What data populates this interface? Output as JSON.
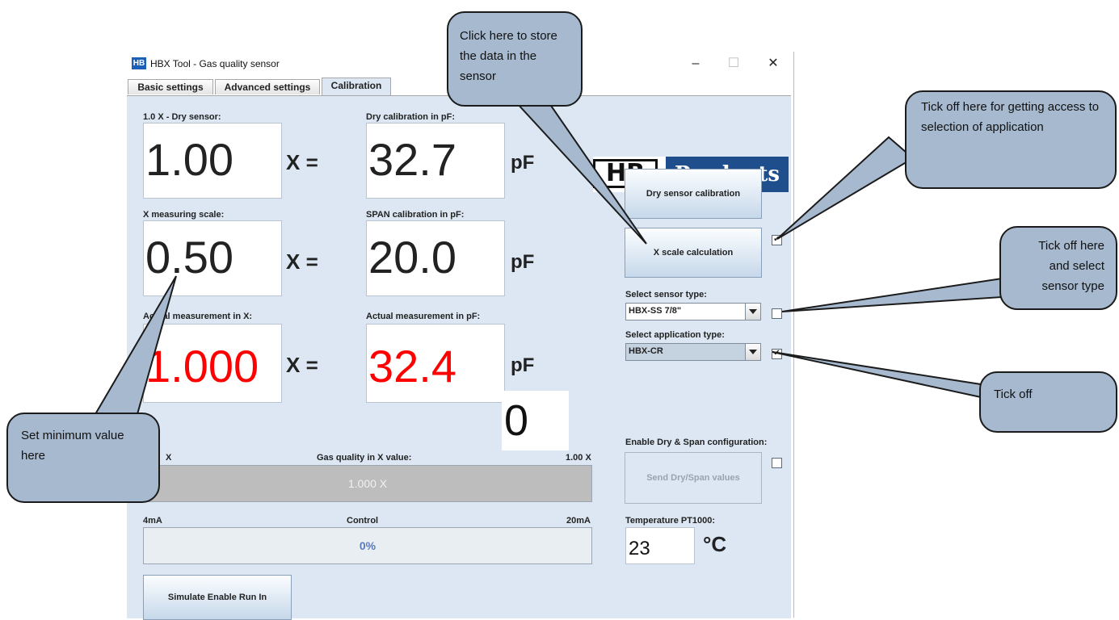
{
  "window": {
    "icon_text": "HB",
    "title": "HBX Tool - Gas quality sensor",
    "minimize": "–",
    "maximize": "☐",
    "close": "✕"
  },
  "tabs": [
    {
      "label": "Basic settings"
    },
    {
      "label": "Advanced settings"
    },
    {
      "label": "Calibration",
      "active": true
    }
  ],
  "calibration": {
    "dry_sensor_label": "1.0 X - Dry sensor:",
    "dry_sensor_value": "1.00",
    "dry_cal_label": "Dry calibration in pF:",
    "dry_cal_value": "32.7",
    "x_scale_label": "X measuring scale:",
    "x_scale_value": "0.50",
    "span_cal_label": "SPAN calibration in pF:",
    "span_cal_value": "20.0",
    "actual_x_label": "Actual measurement in X:",
    "actual_x_value": "1.000",
    "actual_pf_label": "Actual measurement in pF:",
    "actual_pf_value": "32.4",
    "eq": "X =",
    "unit_pf": "pF",
    "overlay_zero": "0",
    "gas_quality_label": "Gas quality in X value:",
    "gas_quality_min": "X",
    "gas_quality_max": "1.00 X",
    "gas_quality_value": "1.000 X",
    "control_label": "Control",
    "control_min": "4mA",
    "control_max": "20mA",
    "control_value": "0%",
    "simulate_button": "Simulate Enable Run In"
  },
  "logo": {
    "left": "HB",
    "right": "Products"
  },
  "right_panel": {
    "dry_button": "Dry sensor calibration",
    "xscale_button": "X scale calculation",
    "xscale_checked": "✔",
    "sensor_type_label": "Select sensor type:",
    "sensor_type_value": "HBX-SS 7/8\"",
    "app_type_label": "Select application type:",
    "app_type_value": "HBX-CR",
    "app_checked": "✔",
    "enable_label": "Enable Dry & Span configuration:",
    "send_button": "Send Dry/Span values",
    "temp_label": "Temperature PT1000:",
    "temp_value": "23",
    "temp_unit": "°C"
  },
  "colors": {
    "panel": "#dce7f3",
    "measurement_red": "#ff0000",
    "callout_fill": "#a6b9cf",
    "brand_blue": "#1f4e8c"
  },
  "callouts": {
    "store": "Click here to store the data in the sensor",
    "access": "Tick off here for getting access  to selection of application",
    "sensor": "Tick off here and select sensor type",
    "tickoff": "Tick off",
    "minimum": "Set minimum value here"
  }
}
